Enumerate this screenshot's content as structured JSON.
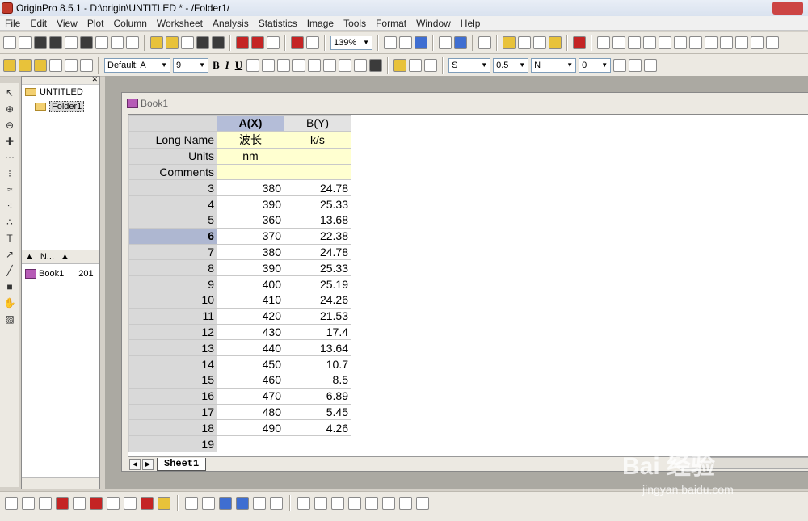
{
  "window": {
    "title": "OriginPro 8.5.1 - D:\\origin\\UNTITLED * - /Folder1/"
  },
  "menu": [
    "File",
    "Edit",
    "View",
    "Plot",
    "Column",
    "Worksheet",
    "Analysis",
    "Statistics",
    "Image",
    "Tools",
    "Format",
    "Window",
    "Help"
  ],
  "toolbar1": {
    "zoom": "139%"
  },
  "toolbar2": {
    "font": "Default: A",
    "font_size": "9",
    "bold": "B",
    "italic": "I",
    "underline": "U",
    "line_style_label": "S",
    "line_width": "0.5",
    "fill_label": "N",
    "pattern": "0"
  },
  "project": {
    "root": "UNTITLED",
    "folder": "Folder1",
    "list_header": "N...",
    "items": [
      {
        "name": "Book1",
        "date": "201"
      }
    ]
  },
  "book": {
    "title": "Book1",
    "columns": [
      {
        "header": "A(X)",
        "long_name": "波长",
        "units": "nm",
        "comments": ""
      },
      {
        "header": "B(Y)",
        "long_name": "k/s",
        "units": "",
        "comments": ""
      }
    ],
    "meta_labels": {
      "long_name": "Long Name",
      "units": "Units",
      "comments": "Comments"
    },
    "rows": [
      {
        "n": "3",
        "a": "380",
        "b": "24.78"
      },
      {
        "n": "4",
        "a": "390",
        "b": "25.33"
      },
      {
        "n": "5",
        "a": "360",
        "b": "13.68"
      },
      {
        "n": "6",
        "a": "370",
        "b": "22.38"
      },
      {
        "n": "7",
        "a": "380",
        "b": "24.78"
      },
      {
        "n": "8",
        "a": "390",
        "b": "25.33"
      },
      {
        "n": "9",
        "a": "400",
        "b": "25.19"
      },
      {
        "n": "10",
        "a": "410",
        "b": "24.26"
      },
      {
        "n": "11",
        "a": "420",
        "b": "21.53"
      },
      {
        "n": "12",
        "a": "430",
        "b": "17.4"
      },
      {
        "n": "13",
        "a": "440",
        "b": "13.64"
      },
      {
        "n": "14",
        "a": "450",
        "b": "10.7"
      },
      {
        "n": "15",
        "a": "460",
        "b": "8.5"
      },
      {
        "n": "16",
        "a": "470",
        "b": "6.89"
      },
      {
        "n": "17",
        "a": "480",
        "b": "5.45"
      },
      {
        "n": "18",
        "a": "490",
        "b": "4.26"
      },
      {
        "n": "19",
        "a": "",
        "b": ""
      }
    ],
    "sheet_tab": "Sheet1"
  },
  "watermark": {
    "text": "Bai 经验",
    "sub": "jingyan.baidu.com"
  }
}
